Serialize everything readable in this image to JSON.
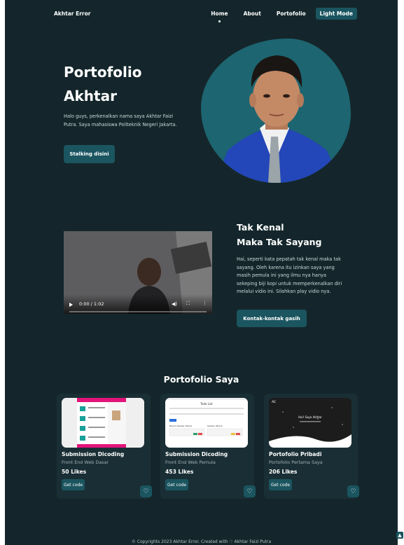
{
  "nav": {
    "brand": "Akhtar Error",
    "links": [
      "Home",
      "About",
      "Portofolio"
    ],
    "mode_button": "Light Mode"
  },
  "hero": {
    "title_line1": "Portofolio",
    "title_line2": "Akhtar",
    "description": "Halo guys, perkenalkan nama saya Akhtar Faizi Putra. Saya mahasiswa Politeknik Negeri Jakarta.",
    "button": "Stalking disini"
  },
  "about": {
    "title_line1": "Tak Kenal",
    "title_line2": "Maka Tak Sayang",
    "description": "Hai, seperti kata pepatah tak kenal maka tak sayang. Oleh karena itu izinkan saya yang masih pemula ini yang ilmu nya hanya sekeping biji kopi untuk memperkenalkan diri melalui vidio ini. Silahkan play vidio nya.",
    "button": "Kontak-kontak gasih",
    "video": {
      "time": "0:00 / 1:02"
    }
  },
  "portfolio": {
    "title": "Portofolio Saya",
    "cards": [
      {
        "title": "Submission Dicoding",
        "subtitle": "Front End Web Dasar",
        "likes": "50 Likes",
        "button": "Get code"
      },
      {
        "title": "Submission Dicoding",
        "subtitle": "Front End Web Pemula",
        "likes": "453 Likes",
        "button": "Get code",
        "thumb_heading": "Todo List",
        "thumb_col1": "Belum Selesai dibaca",
        "thumb_col2": "Selesai dibaca"
      },
      {
        "title": "Portofolio Pribadi",
        "subtitle": "Portofolio Pertama Saya",
        "likes": "206 Likes",
        "button": "Get code",
        "thumb_heading": "Hai! Saya Akhtar",
        "thumb_logo": "AE"
      }
    ]
  },
  "footer": {
    "text": "© Copyrights 2023 Akhtar Error. Created with ♡ Akhtar Faizi Putra"
  },
  "colors": {
    "background": "#14262b",
    "accent": "#1b5560",
    "blob": "#1d6570",
    "card": "#1a2f35"
  },
  "icons": {
    "heart": "heart-icon",
    "play": "play-icon",
    "volume": "volume-icon",
    "fullscreen": "fullscreen-icon",
    "more": "more-icon",
    "scroll_top": "arrow-up-icon"
  }
}
